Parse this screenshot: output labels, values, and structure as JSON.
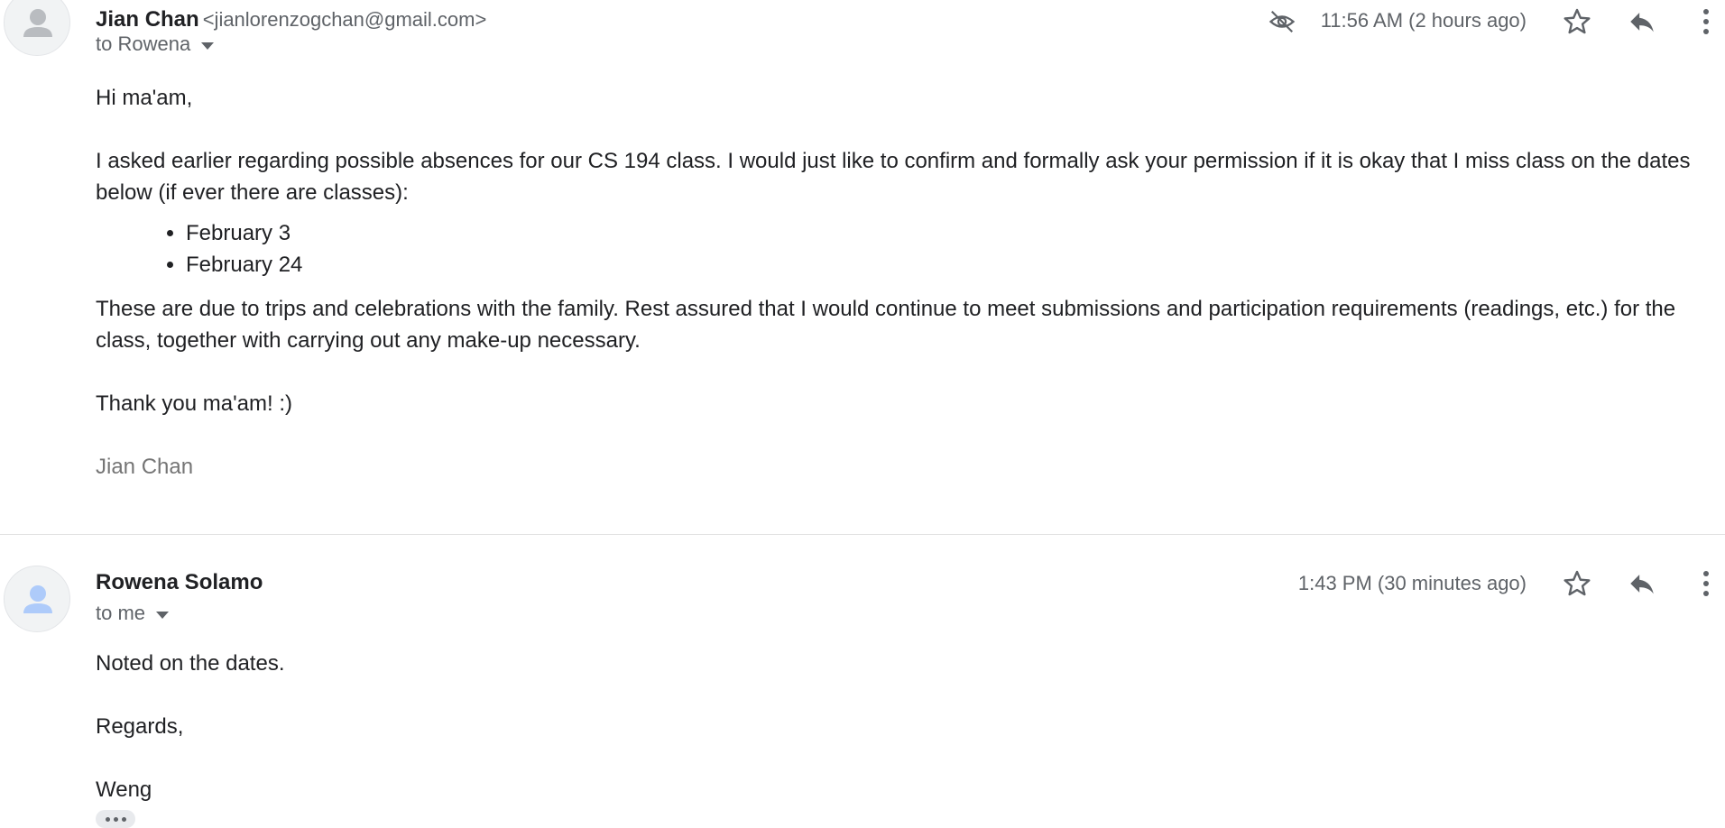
{
  "messages": [
    {
      "sender_name": "Jian Chan",
      "sender_email": "<jianlorenzogchan@gmail.com>",
      "recipient": "to Rowena",
      "time": "11:56 AM (2 hours ago)",
      "icons": [
        "visibility-off-icon",
        "star-icon",
        "reply-icon",
        "more-vert-icon"
      ],
      "body": {
        "greeting": "Hi ma'am,",
        "paragraph1": "I asked earlier regarding possible absences for our CS 194 class. I would just like to confirm and formally ask your permission if it is okay that I miss class on the dates below (if ever there are classes):",
        "dates": [
          "February 3",
          "February 24"
        ],
        "paragraph2": "These are due to trips and celebrations with the family. Rest assured that I would continue to meet submissions and participation requirements (readings, etc.) for the class, together with carrying out any make-up necessary.",
        "closing": "Thank you ma'am! :)",
        "signature": "Jian Chan"
      }
    },
    {
      "sender_name": "Rowena Solamo",
      "recipient": "to me",
      "time": "1:43 PM (30 minutes ago)",
      "icons": [
        "star-icon",
        "reply-icon",
        "more-vert-icon"
      ],
      "body": {
        "line1": "Noted on the dates.",
        "line2": "Regards,",
        "line3": "Weng"
      }
    }
  ],
  "colors": {
    "text": "#202124",
    "secondary": "#5f6368",
    "signature": "#757575",
    "avatar_bg": "#f1f3f4",
    "avatar_grey": "#b9bcc0",
    "avatar_blue": "#aecbfa"
  }
}
